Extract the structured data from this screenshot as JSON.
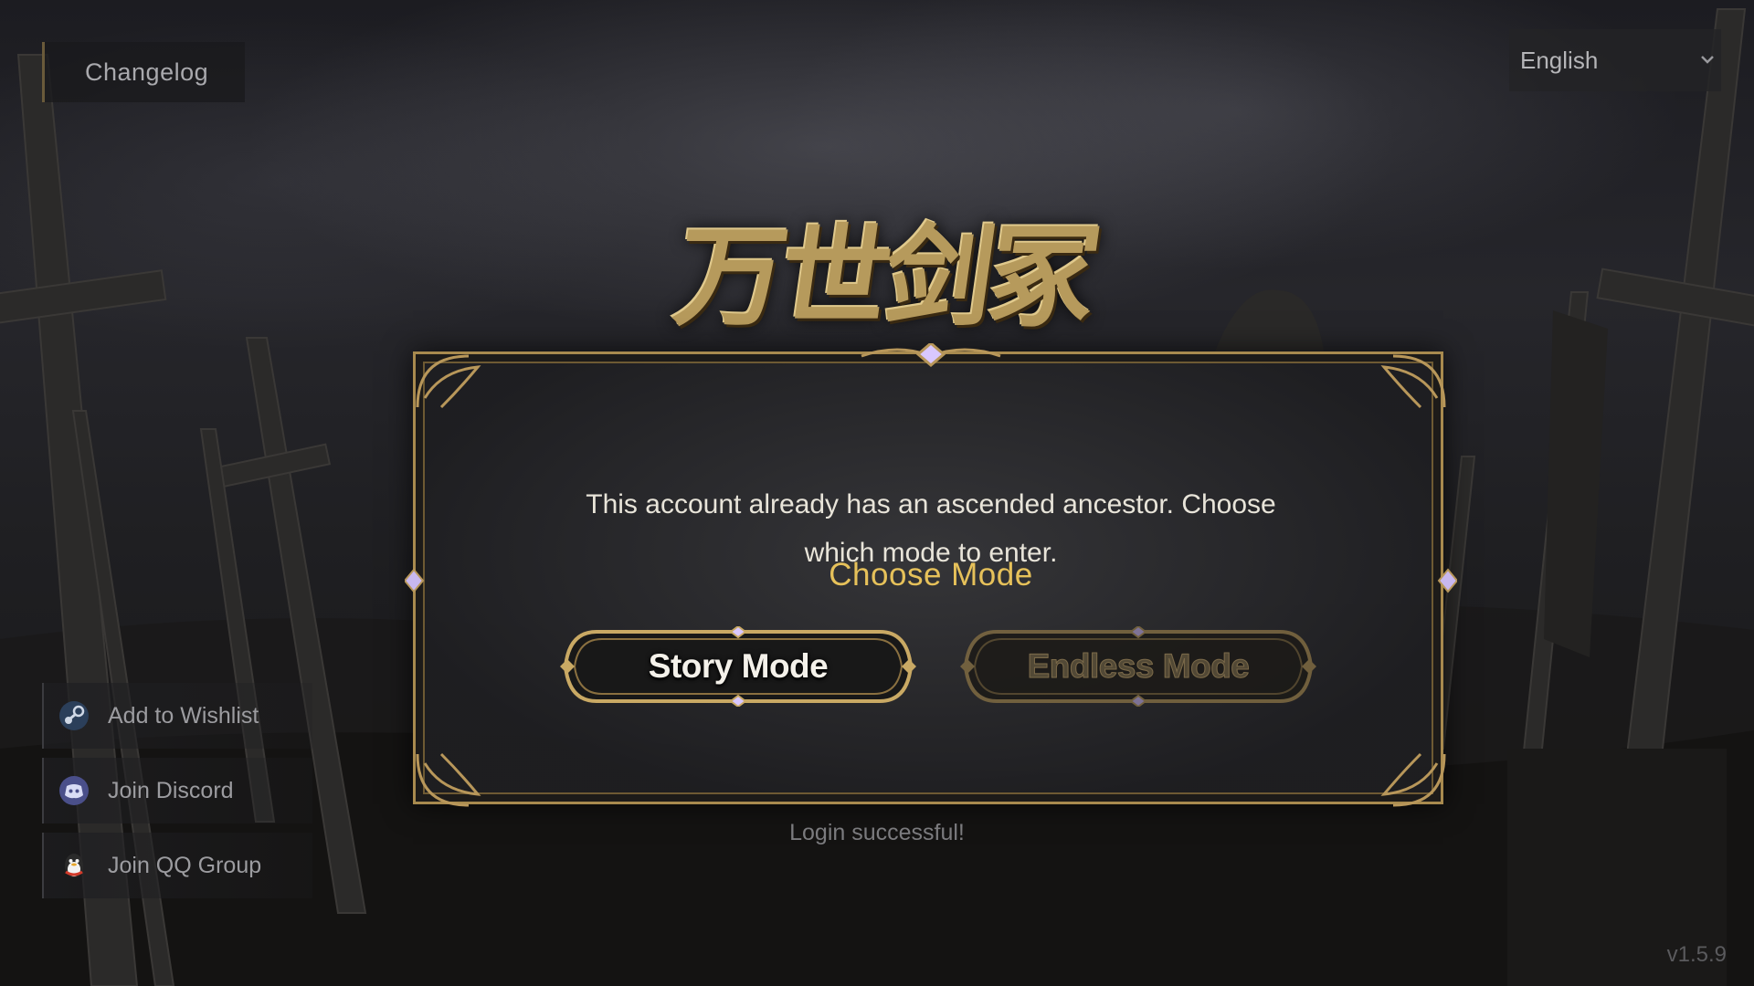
{
  "header": {
    "changelog_label": "Changelog",
    "language": {
      "selected": "English",
      "icon": "chevron-down-icon"
    }
  },
  "logo": {
    "text": "万世剑冢"
  },
  "dialog": {
    "message": "This account already has an ascended ancestor. Choose which mode to enter.",
    "title": "Choose Mode",
    "buttons": [
      {
        "label": "Story Mode",
        "state": "enabled"
      },
      {
        "label": "Endless Mode",
        "state": "disabled"
      }
    ]
  },
  "status": {
    "text": "Login successful!"
  },
  "social": {
    "items": [
      {
        "label": "Add to Wishlist",
        "icon": "steam-icon"
      },
      {
        "label": "Join Discord",
        "icon": "discord-icon"
      },
      {
        "label": "Join QQ Group",
        "icon": "qq-icon"
      }
    ]
  },
  "footer": {
    "version": "v1.5.9"
  },
  "colors": {
    "accent_gold": "#e6c15a",
    "frame_gold": "#a88a4e",
    "text_light": "#e8e4d9"
  }
}
